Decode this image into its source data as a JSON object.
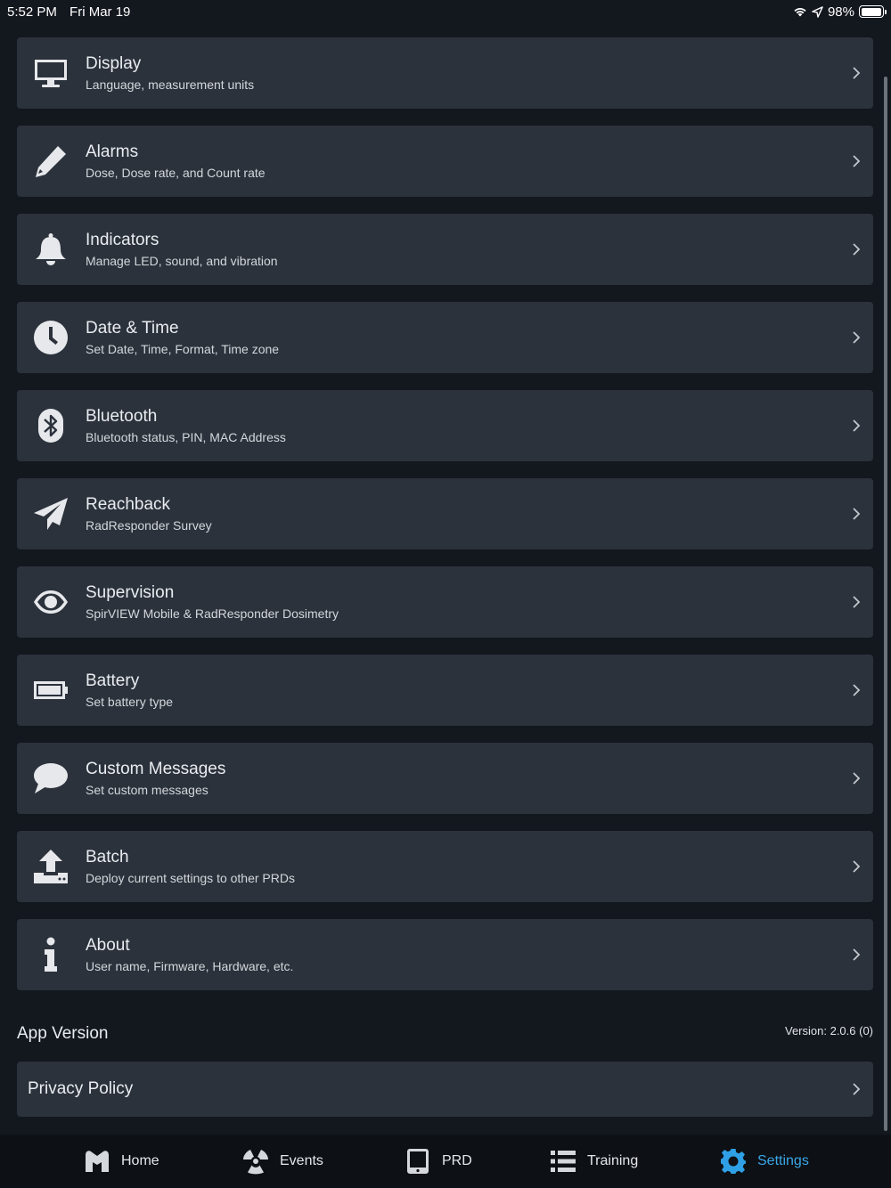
{
  "status_bar": {
    "time": "5:52 PM",
    "date": "Fri Mar 19",
    "battery": "98%"
  },
  "settings_rows": [
    {
      "icon": "monitor-icon",
      "title": "Display",
      "subtitle": "Language, measurement units"
    },
    {
      "icon": "pencil-icon",
      "title": "Alarms",
      "subtitle": "Dose, Dose rate, and Count rate"
    },
    {
      "icon": "bell-icon",
      "title": "Indicators",
      "subtitle": "Manage LED, sound, and vibration"
    },
    {
      "icon": "clock-icon",
      "title": "Date & Time",
      "subtitle": "Set Date, Time, Format, Time zone"
    },
    {
      "icon": "bluetooth-icon",
      "title": "Bluetooth",
      "subtitle": "Bluetooth status, PIN, MAC Address"
    },
    {
      "icon": "paper-plane-icon",
      "title": "Reachback",
      "subtitle": "RadResponder Survey"
    },
    {
      "icon": "eye-icon",
      "title": "Supervision",
      "subtitle": "SpirVIEW Mobile & RadResponder Dosimetry"
    },
    {
      "icon": "battery-icon",
      "title": "Battery",
      "subtitle": "Set battery type"
    },
    {
      "icon": "chat-bubble-icon",
      "title": "Custom Messages",
      "subtitle": "Set custom messages"
    },
    {
      "icon": "upload-icon",
      "title": "Batch",
      "subtitle": "Deploy current settings to other PRDs"
    },
    {
      "icon": "info-icon",
      "title": "About",
      "subtitle": "User name, Firmware, Hardware, etc."
    }
  ],
  "app_version": {
    "label": "App Version",
    "value": "Version: 2.0.6 (0)"
  },
  "privacy_policy": {
    "label": "Privacy Policy"
  },
  "tabs": [
    {
      "icon": "home-icon",
      "label": "Home",
      "active": false
    },
    {
      "icon": "radiation-icon",
      "label": "Events",
      "active": false
    },
    {
      "icon": "device-icon",
      "label": "PRD",
      "active": false
    },
    {
      "icon": "list-icon",
      "label": "Training",
      "active": false
    },
    {
      "icon": "gear-icon",
      "label": "Settings",
      "active": true
    }
  ],
  "colors": {
    "background": "#13171e",
    "row": "#2c323c",
    "tab_bar": "#0d1015",
    "accent": "#2fa0e6"
  }
}
